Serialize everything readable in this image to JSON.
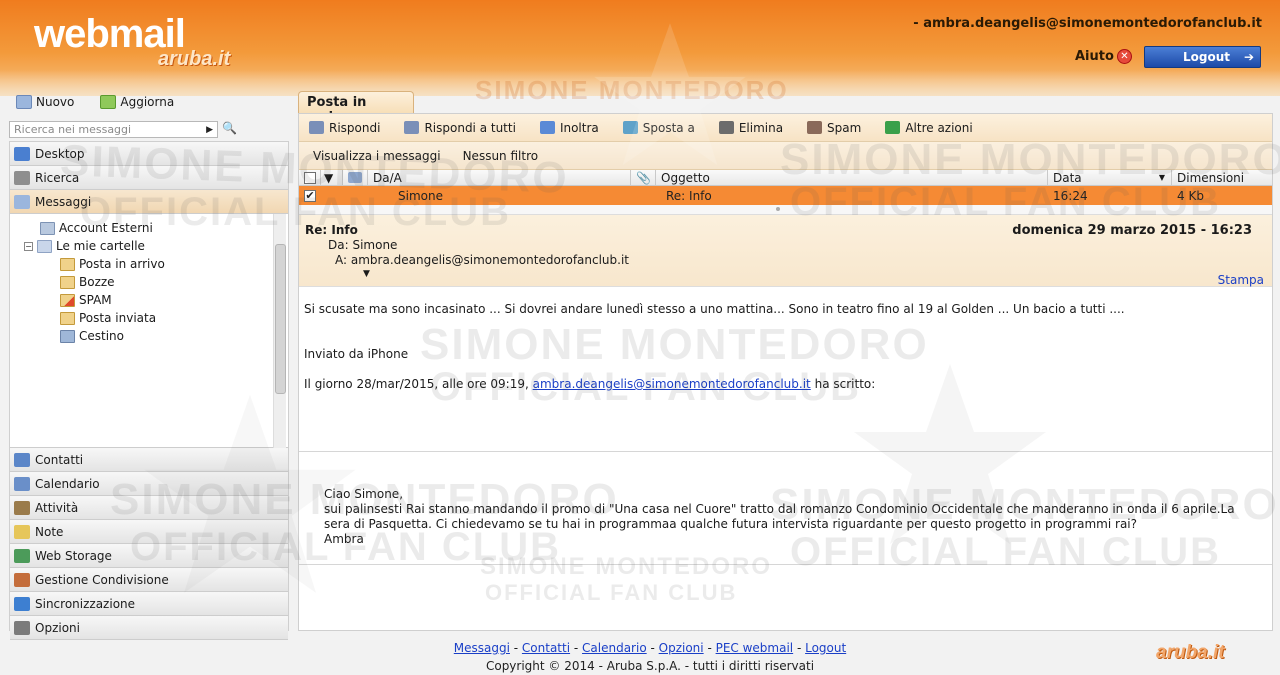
{
  "header": {
    "logo_text": "webmail",
    "logo_sub": "aruba.it",
    "user_email": "- ambra.deangelis@simonemontedorofanclub.it",
    "help_label": "Aiuto",
    "logout_label": "Logout"
  },
  "left": {
    "new_label": "Nuovo",
    "refresh_label": "Aggiorna",
    "search_placeholder": "Ricerca nei messaggi",
    "nav_top": [
      {
        "label": "Desktop",
        "icon": "desktop-icon",
        "color": "#4a7fd0"
      },
      {
        "label": "Ricerca",
        "icon": "magnifier-icon",
        "color": "#8e8e8e"
      },
      {
        "label": "Messaggi",
        "icon": "envelope-icon",
        "color": "#9bb6dd"
      }
    ],
    "tree": {
      "external": "Account Esterni",
      "my_folders": "Le mie cartelle",
      "folders": [
        "Posta in arrivo",
        "Bozze",
        "SPAM",
        "Posta inviata",
        "Cestino"
      ]
    },
    "nav_bottom": [
      {
        "label": "Contatti",
        "icon": "address-book-icon",
        "color": "#5b86c8"
      },
      {
        "label": "Calendario",
        "icon": "calendar-icon",
        "color": "#6a8fc9"
      },
      {
        "label": "Attività",
        "icon": "tasks-icon",
        "color": "#9a7b4b"
      },
      {
        "label": "Note",
        "icon": "note-icon",
        "color": "#e6c65a"
      },
      {
        "label": "Web Storage",
        "icon": "storage-icon",
        "color": "#4c9b5a"
      },
      {
        "label": "Gestione Condivisione",
        "icon": "share-icon",
        "color": "#c46d3b"
      },
      {
        "label": "Sincronizzazione",
        "icon": "sync-icon",
        "color": "#3d7fd1"
      },
      {
        "label": "Opzioni",
        "icon": "options-icon",
        "color": "#7b7b7b"
      }
    ]
  },
  "main": {
    "tab_label": "Posta in arrivo",
    "toolbar": [
      {
        "label": "Rispondi",
        "icon": "reply-icon",
        "color": "#7a8fb8"
      },
      {
        "label": "Rispondi a tutti",
        "icon": "reply-all-icon",
        "color": "#7a8fb8"
      },
      {
        "label": "Inoltra",
        "icon": "forward-icon",
        "color": "#5a8ad6"
      },
      {
        "label": "Sposta a",
        "icon": "move-icon",
        "color": "#5fa2c9"
      },
      {
        "label": "Elimina",
        "icon": "trash-icon",
        "color": "#6c6c6c"
      },
      {
        "label": "Spam",
        "icon": "spam-icon",
        "color": "#8a6a5a"
      },
      {
        "label": "Altre azioni",
        "icon": "plus-icon",
        "color": "#3aa04a"
      }
    ],
    "filters": [
      "Visualizza i messaggi",
      "Nessun filtro"
    ],
    "columns": {
      "from": "Da/A",
      "subject": "Oggetto",
      "date": "Data",
      "size": "Dimensioni"
    },
    "rows": [
      {
        "from": "Simone",
        "subject": "Re: Info",
        "date": "16:24",
        "size": "4 Kb"
      }
    ],
    "message": {
      "subject": "Re: Info",
      "date": "domenica 29 marzo 2015 - 16:23",
      "from_label": "Da:",
      "from": "Simone",
      "to_label": "A:",
      "to": "ambra.deangelis@simonemontedorofanclub.it",
      "print_label": "Stampa",
      "body_line1": "Si scusate ma sono incasinato ... Si dovrei andare lunedì stesso a uno mattina... Sono in teatro fino al 19 al Golden ... Un bacio a tutti ....",
      "body_line2": "Inviato da iPhone",
      "body_line3_pre": "Il giorno 28/mar/2015, alle ore 09:19,",
      "body_line3_link": "ambra.deangelis@simonemontedorofanclub.it",
      "body_line3_post": "ha scritto:",
      "quote_line1": "Ciao Simone,",
      "quote_line2": "sui palinsesti Rai stanno mandando il promo di \"Una casa nel Cuore\"  tratto dal romanzo Condominio Occidentale che manderanno in onda il 6 aprile.La sera di Pasquetta. Ci chiedevamo se tu hai in programmaa qualche futura intervista riguardante per questo progetto in programmi rai?",
      "quote_line3": "Ambra"
    }
  },
  "footer": {
    "links": [
      "Messaggi",
      "Contatti",
      "Calendario",
      "Opzioni",
      "PEC webmail",
      "Logout"
    ],
    "copyright": "Copyright © 2014 - Aruba S.p.A. - tutti i diritti riservati",
    "brand": "aruba.it"
  },
  "watermark": {
    "line1": "SIMONE MONTEDORO",
    "line2": "OFFICIAL FAN CLUB"
  }
}
